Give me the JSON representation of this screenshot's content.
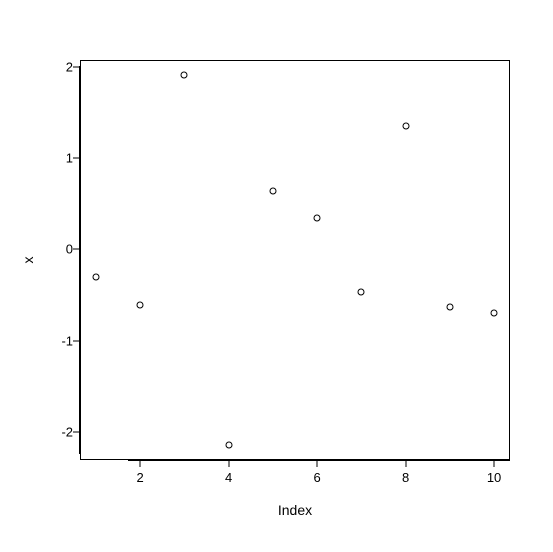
{
  "chart_data": {
    "type": "scatter",
    "x": [
      1,
      2,
      3,
      4,
      5,
      6,
      7,
      8,
      9,
      10
    ],
    "y": [
      -0.3,
      -0.61,
      1.91,
      -2.14,
      0.64,
      0.34,
      -0.47,
      1.35,
      -0.63,
      -0.7
    ],
    "xlabel": "Index",
    "ylabel": "x",
    "xlim": [
      1,
      10
    ],
    "ylim": [
      -2.14,
      1.91
    ],
    "x_ticks": [
      2,
      4,
      6,
      8,
      10
    ],
    "y_ticks": [
      -2,
      -1,
      0,
      1,
      2
    ]
  }
}
